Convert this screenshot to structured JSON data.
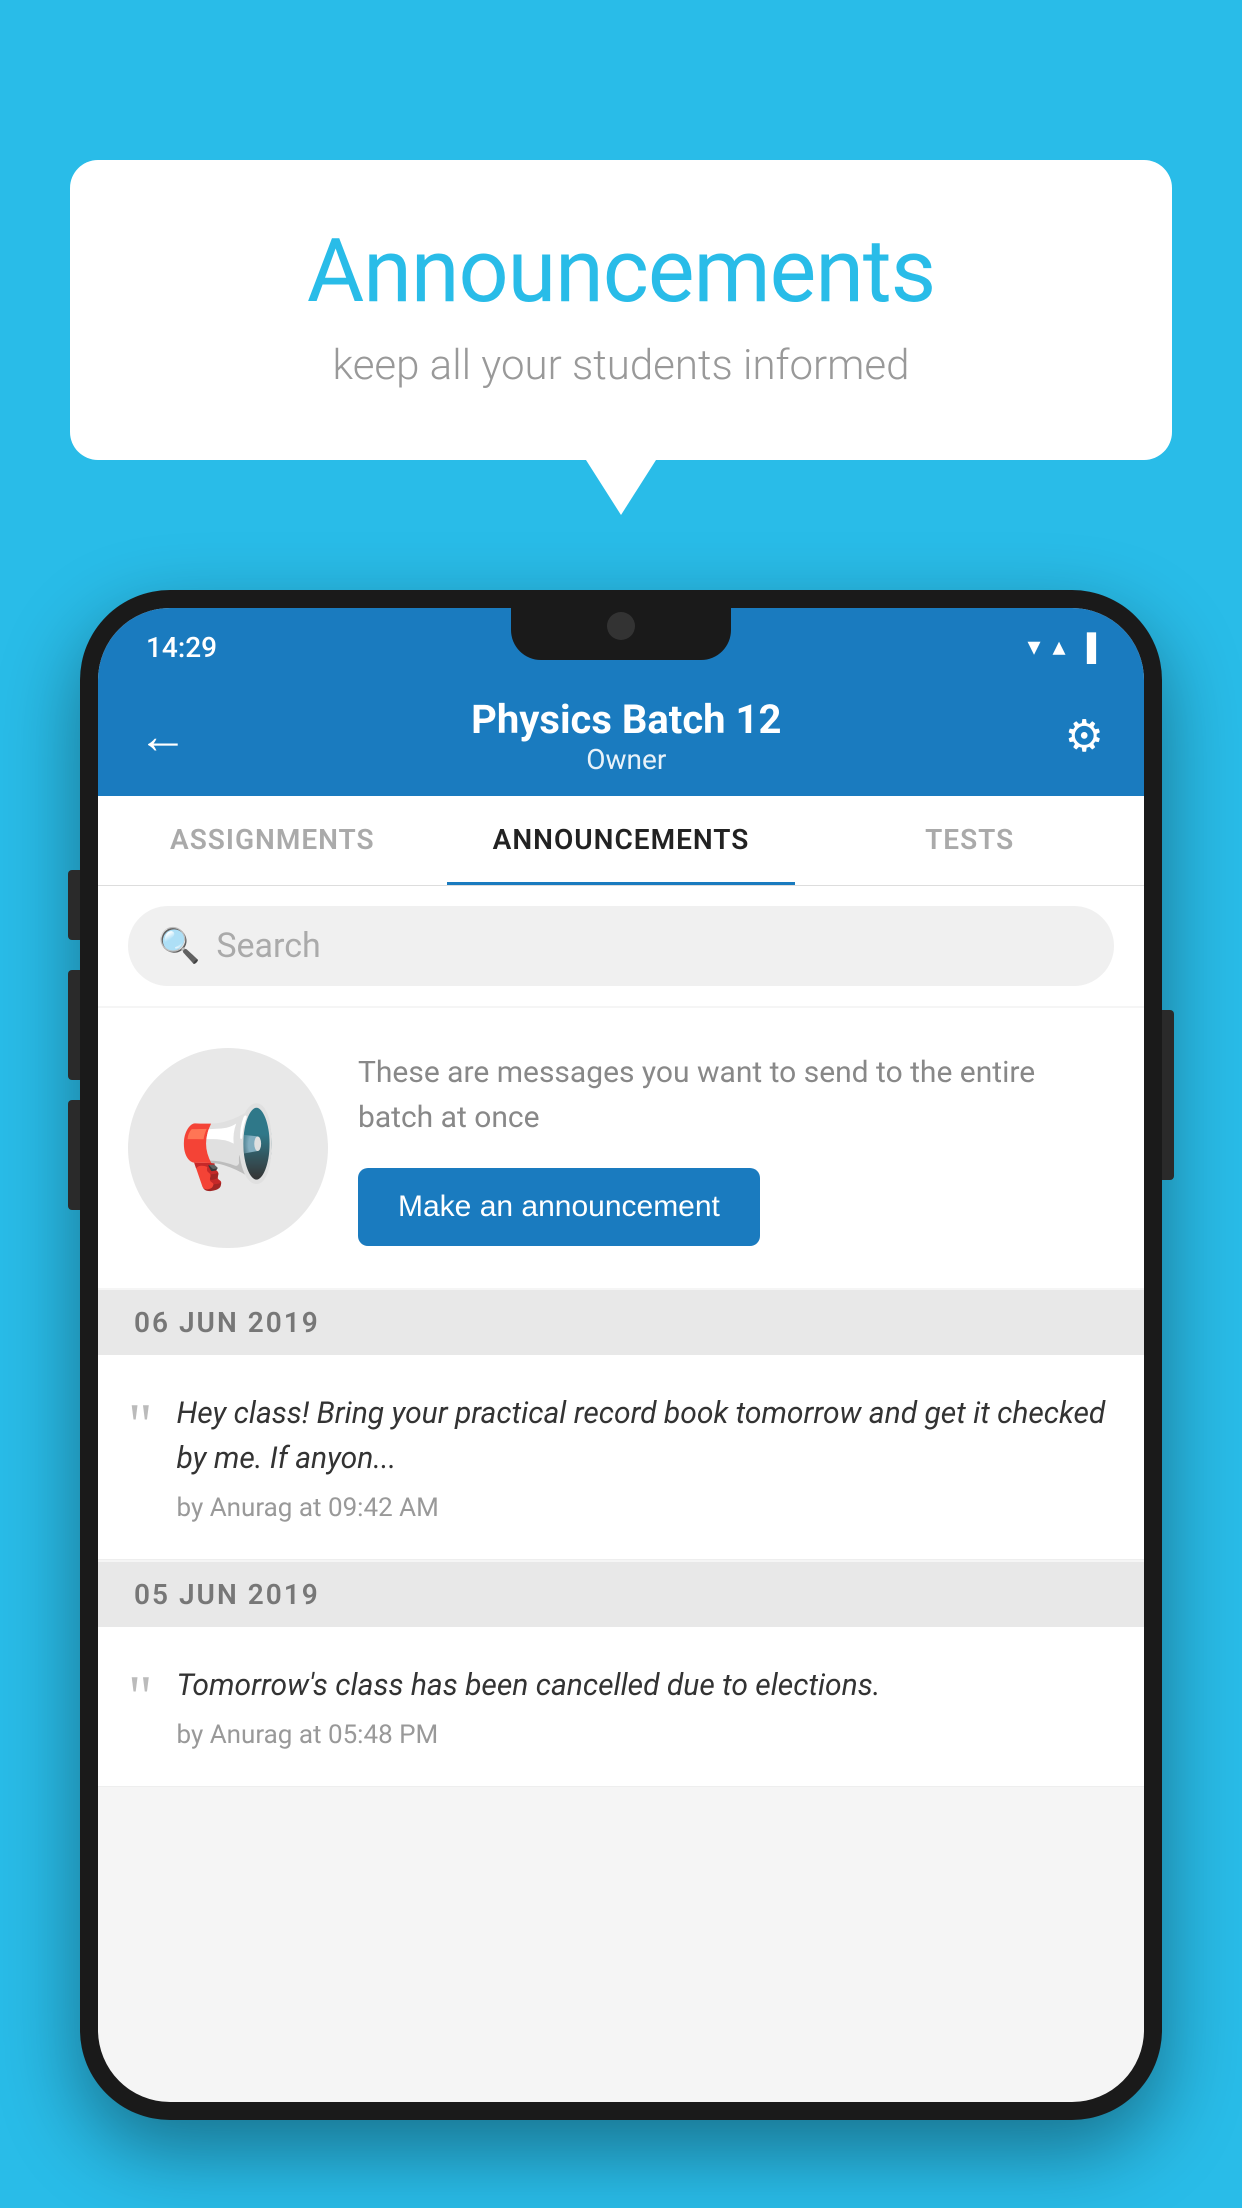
{
  "background_color": "#29bce8",
  "speech_bubble": {
    "title": "Announcements",
    "subtitle": "keep all your students informed"
  },
  "phone": {
    "status_bar": {
      "time": "14:29",
      "wifi_symbol": "▼",
      "signal_symbol": "▲",
      "battery_symbol": "▐"
    },
    "app_bar": {
      "back_label": "←",
      "title": "Physics Batch 12",
      "subtitle": "Owner",
      "gear_symbol": "⚙"
    },
    "tabs": [
      {
        "label": "ASSIGNMENTS",
        "active": false
      },
      {
        "label": "ANNOUNCEMENTS",
        "active": true
      },
      {
        "label": "TESTS",
        "active": false
      }
    ],
    "search": {
      "placeholder": "Search"
    },
    "promo": {
      "description": "These are messages you want to send to the entire batch at once",
      "button_label": "Make an announcement"
    },
    "announcements": [
      {
        "date": "06  JUN  2019",
        "text": "Hey class! Bring your practical record book tomorrow and get it checked by me. If anyon...",
        "meta": "by Anurag at 09:42 AM"
      },
      {
        "date": "05  JUN  2019",
        "text": "Tomorrow's class has been cancelled due to elections.",
        "meta": "by Anurag at 05:48 PM"
      }
    ]
  }
}
